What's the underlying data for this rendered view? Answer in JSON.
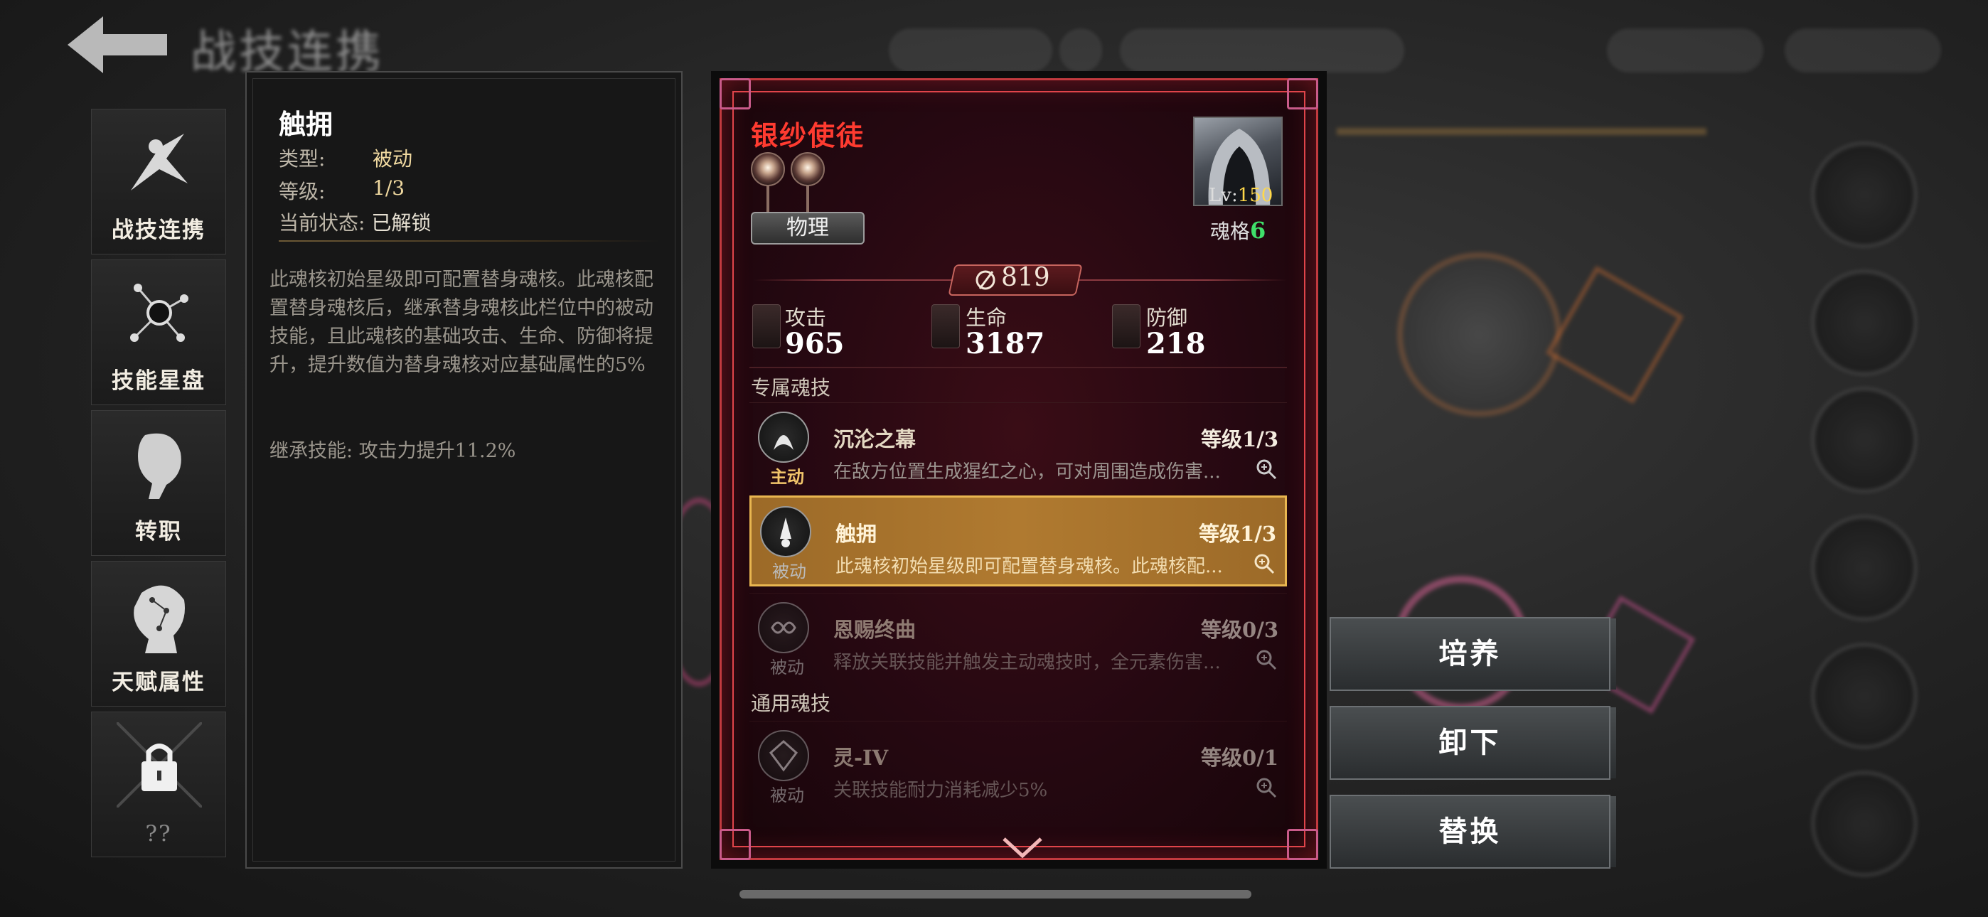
{
  "header": {
    "title": "战技连携",
    "blurred_top_items": [
      "",
      "",
      "",
      ""
    ]
  },
  "nav": [
    {
      "label": "战技连携",
      "icon": "warrior-icon"
    },
    {
      "label": "技能星盘",
      "icon": "star-map-icon"
    },
    {
      "label": "转职",
      "icon": "profile-icon"
    },
    {
      "label": "天赋属性",
      "icon": "constellation-icon"
    },
    {
      "label": "??",
      "icon": "lock-icon"
    }
  ],
  "info": {
    "title": "触拥",
    "type_label": "类型:",
    "type_value": "被动",
    "level_label": "等级:",
    "level_value": "1/3",
    "state_label": "当前状态:",
    "state_value": "已解锁",
    "description": "此魂核初始星级即可配置替身魂核。此魂核配置替身魂核后，继承替身魂核此栏位中的被动技能，且此魂核的基础攻击、生命、防御将提升，提升数值为替身魂核对应基础属性的5%",
    "inherit": "继承技能: 攻击力提升11.2%"
  },
  "card": {
    "name": "银纱使徒",
    "element_tag": "物理",
    "level_label": "Lv:",
    "level": "150",
    "soul_label": "魂格",
    "soul_value": "6",
    "power": "819",
    "stats": [
      {
        "label": "攻击",
        "value": "965",
        "icon": "sword-icon"
      },
      {
        "label": "生命",
        "value": "3187",
        "icon": "heart-icon"
      },
      {
        "label": "防御",
        "value": "218",
        "icon": "shield-icon"
      }
    ],
    "section_exclusive": "专属魂技",
    "section_general": "通用魂技",
    "skills": [
      {
        "type": "主动",
        "name": "沉沦之幕",
        "level": "等级1/3",
        "desc": "在敌方位置生成猩红之心，可对周围造成伤害..."
      },
      {
        "type": "被动",
        "name": "触拥",
        "level": "等级1/3",
        "desc": "此魂核初始星级即可配置替身魂核。此魂核配..."
      },
      {
        "type": "被动",
        "name": "恩赐终曲",
        "level": "等级0/3",
        "desc": "释放关联技能并触发主动魂技时，全元素伤害..."
      },
      {
        "type": "被动",
        "name": "灵-IV",
        "level": "等级0/1",
        "desc": "关联技能耐力消耗减少5%"
      }
    ]
  },
  "actions": {
    "cultivate": "培养",
    "unequip": "卸下",
    "replace": "替换"
  },
  "colors": {
    "accent_red": "#ff3b30",
    "selected_row": "#b07a30",
    "soul_green": "#3fe06a",
    "level_yellow": "#ffd84a"
  }
}
